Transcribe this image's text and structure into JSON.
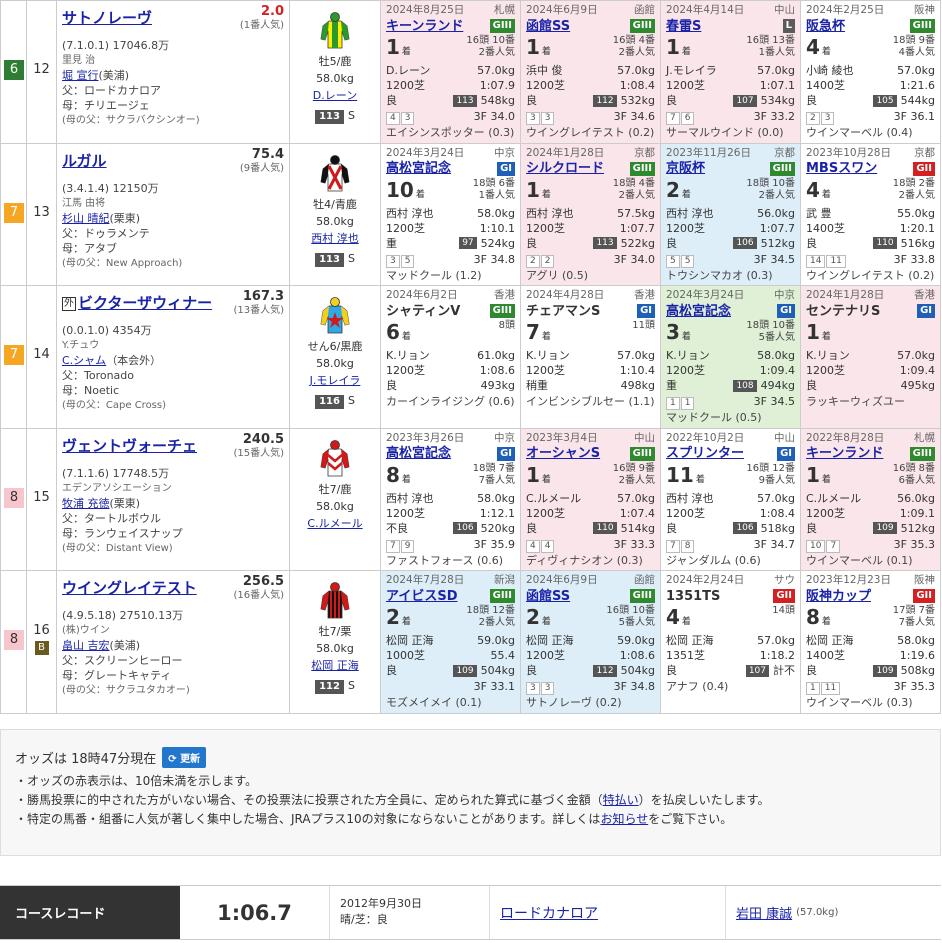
{
  "horses": [
    {
      "waku": "6",
      "waku_color": "#2e7d32",
      "waku_text_color": "#ffffff",
      "umaban": "12",
      "gaikoku": "",
      "blinker": "",
      "name": "サトノレーヴ",
      "odds": "2.0",
      "popularity": "(1番人気)",
      "record": "(7.1.0.1)",
      "prize": "17046.8万",
      "owner": "里見 治",
      "trainer": "堀 宣行",
      "trainer_loc": "(美浦)",
      "sire": "父：ロードカナロア",
      "dam": "母：チリエージェ",
      "damsire": "(母の父：サクラバクシンオー)",
      "sexage": "牡5/鹿",
      "weight": "58.0kg",
      "jockey": "D.レーン",
      "index": "113",
      "index_suffix": "S",
      "silk": {
        "body": "#ffee00",
        "sleeve": "#2b9a2b",
        "pattern": "stripe",
        "pattern_color": "#2b9a2b"
      },
      "past": [
        {
          "bg": "pink",
          "date": "2024年8月25日",
          "venue": "札幌",
          "race": "キーンランド",
          "link": true,
          "grade": "GIII",
          "gclass": "g3",
          "pos": "1",
          "field": "16頭 10番",
          "field2": "2番人気",
          "jockey": "D.レーン",
          "kg": "57.0kg",
          "dist": "1200芝",
          "time": "1:07.9",
          "track": "良",
          "idx": "113",
          "bw": "548kg",
          "n1": "4",
          "n2": "3",
          "l3f": "3F 34.0",
          "winner": "エイシンスポッター (0.3)"
        },
        {
          "bg": "pink",
          "date": "2024年6月9日",
          "venue": "函館",
          "race": "函館SS",
          "link": true,
          "grade": "GIII",
          "gclass": "g3",
          "pos": "1",
          "field": "16頭 4番",
          "field2": "2番人気",
          "jockey": "浜中 俊",
          "kg": "57.0kg",
          "dist": "1200芝",
          "time": "1:08.4",
          "track": "良",
          "idx": "112",
          "bw": "532kg",
          "n1": "3",
          "n2": "3",
          "l3f": "3F 34.6",
          "winner": "ウイングレイテスト (0.2)"
        },
        {
          "bg": "pink",
          "date": "2024年4月14日",
          "venue": "中山",
          "race": "春雷S",
          "link": true,
          "grade": "L",
          "gclass": "gL",
          "pos": "1",
          "field": "16頭 13番",
          "field2": "1番人気",
          "jockey": "J.モレイラ",
          "kg": "57.0kg",
          "dist": "1200芝",
          "time": "1:07.1",
          "track": "良",
          "idx": "107",
          "bw": "534kg",
          "n1": "7",
          "n2": "6",
          "l3f": "3F 33.2",
          "winner": "サーマルウインド (0.0)"
        },
        {
          "bg": "white",
          "date": "2024年2月25日",
          "venue": "阪神",
          "race": "阪急杯",
          "link": true,
          "grade": "GIII",
          "gclass": "g3",
          "pos": "4",
          "field": "18頭 9番",
          "field2": "4番人気",
          "jockey": "小崎 綾也",
          "kg": "57.0kg",
          "dist": "1400芝",
          "time": "1:21.6",
          "track": "良",
          "idx": "105",
          "bw": "544kg",
          "n1": "2",
          "n2": "3",
          "l3f": "3F 36.1",
          "winner": "ウインマーベル (0.4)"
        }
      ]
    },
    {
      "waku": "7",
      "waku_color": "#f5a623",
      "waku_text_color": "#ffffff",
      "umaban": "13",
      "gaikoku": "",
      "blinker": "",
      "name": "ルガル",
      "odds": "75.4",
      "popularity": "(9番人気)",
      "record": "(3.4.1.4)",
      "prize": "12150万",
      "owner": "江馬 由将",
      "trainer": "杉山 晴紀",
      "trainer_loc": "(栗東)",
      "sire": "父：ドゥラメンテ",
      "dam": "母：アタブ",
      "damsire": "(母の父：New Approach)",
      "sexage": "牡4/青鹿",
      "weight": "58.0kg",
      "jockey": "西村 淳也",
      "index": "113",
      "index_suffix": "S",
      "silk": {
        "body": "#ffffff",
        "sleeve": "#111111",
        "pattern": "cross",
        "pattern_color": "#d01a1a"
      },
      "past": [
        {
          "bg": "white",
          "date": "2024年3月24日",
          "venue": "中京",
          "race": "高松宮記念",
          "link": true,
          "grade": "GI",
          "gclass": "g1",
          "pos": "10",
          "field": "18頭 6番",
          "field2": "1番人気",
          "jockey": "西村 淳也",
          "kg": "58.0kg",
          "dist": "1200芝",
          "time": "1:10.1",
          "track": "重",
          "idx": "97",
          "bw": "524kg",
          "n1": "3",
          "n2": "5",
          "l3f": "3F 34.8",
          "winner": "マッドクール (1.2)"
        },
        {
          "bg": "pink",
          "date": "2024年1月28日",
          "venue": "京都",
          "race": "シルクロード",
          "link": true,
          "grade": "GIII",
          "gclass": "g3",
          "pos": "1",
          "field": "18頭 4番",
          "field2": "2番人気",
          "jockey": "西村 淳也",
          "kg": "57.5kg",
          "dist": "1200芝",
          "time": "1:07.7",
          "track": "良",
          "idx": "113",
          "bw": "522kg",
          "n1": "2",
          "n2": "2",
          "l3f": "3F 34.0",
          "winner": "アグリ (0.5)"
        },
        {
          "bg": "blue",
          "date": "2023年11月26日",
          "venue": "京都",
          "race": "京阪杯",
          "link": true,
          "grade": "GIII",
          "gclass": "g3",
          "pos": "2",
          "field": "18頭 10番",
          "field2": "2番人気",
          "jockey": "西村 淳也",
          "kg": "56.0kg",
          "dist": "1200芝",
          "time": "1:07.7",
          "track": "良",
          "idx": "106",
          "bw": "512kg",
          "n1": "5",
          "n2": "5",
          "l3f": "3F 34.5",
          "winner": "トウシンマカオ (0.3)"
        },
        {
          "bg": "white",
          "date": "2023年10月28日",
          "venue": "京都",
          "race": "MBSスワン",
          "link": true,
          "grade": "GII",
          "gclass": "g2",
          "pos": "4",
          "field": "18頭 2番",
          "field2": "2番人気",
          "jockey": "武 豊",
          "kg": "55.0kg",
          "dist": "1400芝",
          "time": "1:20.1",
          "track": "良",
          "idx": "110",
          "bw": "516kg",
          "n1": "14",
          "n2": "11",
          "l3f": "3F 33.8",
          "winner": "ウイングレイテスト (0.2)"
        }
      ]
    },
    {
      "waku": "7",
      "waku_color": "#f5a623",
      "waku_text_color": "#ffffff",
      "umaban": "14",
      "gaikoku": "外",
      "blinker": "",
      "name": "ビクターザウィナー",
      "odds": "167.3",
      "popularity": "(13番人気)",
      "record": "(0.0.1.0)",
      "prize": "4354万",
      "owner": "Y.チュウ",
      "trainer": "C.シャム",
      "trainer_loc": "（本会外）",
      "sire": "父：Toronado",
      "dam": "母：Noetic",
      "damsire": "(母の父：Cape Cross)",
      "sexage": "せん6/黒鹿",
      "weight": "58.0kg",
      "jockey": "J.モレイラ",
      "index": "116",
      "index_suffix": "S",
      "silk": {
        "body": "#2ea8e6",
        "sleeve": "#f2d01d",
        "pattern": "star",
        "pattern_color": "#d01a1a"
      },
      "past": [
        {
          "bg": "white",
          "date": "2024年6月2日",
          "venue": "香港",
          "race": "シャティンV",
          "link": false,
          "grade": "GIII",
          "gclass": "g3",
          "pos": "6",
          "field": "8頭",
          "field2": "",
          "jockey": "K.リョン",
          "kg": "61.0kg",
          "dist": "1200芝",
          "time": "1:08.6",
          "track": "良",
          "idx": "",
          "bw": "493kg",
          "n1": "",
          "n2": "",
          "l3f": "",
          "winner": "カーインライジング (0.6)"
        },
        {
          "bg": "white",
          "date": "2024年4月28日",
          "venue": "香港",
          "race": "チェアマンS",
          "link": false,
          "grade": "GI",
          "gclass": "g1",
          "pos": "7",
          "field": "11頭",
          "field2": "",
          "jockey": "K.リョン",
          "kg": "57.0kg",
          "dist": "1200芝",
          "time": "1:10.4",
          "track": "稍重",
          "idx": "",
          "bw": "498kg",
          "n1": "",
          "n2": "",
          "l3f": "",
          "winner": "インビンシブルセー (1.1)"
        },
        {
          "bg": "green",
          "date": "2024年3月24日",
          "venue": "中京",
          "race": "高松宮記念",
          "link": true,
          "grade": "GI",
          "gclass": "g1",
          "pos": "3",
          "field": "18頭 10番",
          "field2": "5番人気",
          "jockey": "K.リョン",
          "kg": "58.0kg",
          "dist": "1200芝",
          "time": "1:09.4",
          "track": "重",
          "idx": "108",
          "bw": "494kg",
          "n1": "1",
          "n2": "1",
          "l3f": "3F 34.5",
          "winner": "マッドクール (0.5)"
        },
        {
          "bg": "pink",
          "date": "2024年1月28日",
          "venue": "香港",
          "race": "センテナリS",
          "link": false,
          "grade": "GI",
          "gclass": "g1",
          "pos": "1",
          "field": "",
          "field2": "",
          "jockey": "K.リョン",
          "kg": "57.0kg",
          "dist": "1200芝",
          "time": "1:09.4",
          "track": "良",
          "idx": "",
          "bw": "495kg",
          "n1": "",
          "n2": "",
          "l3f": "",
          "winner": "ラッキーウィズユー"
        }
      ]
    },
    {
      "waku": "8",
      "waku_color": "#f7c6cc",
      "waku_text_color": "#333333",
      "umaban": "15",
      "gaikoku": "",
      "blinker": "",
      "name": "ヴェントヴォーチェ",
      "odds": "240.5",
      "popularity": "(15番人気)",
      "record": "(7.1.1.6)",
      "prize": "17748.5万",
      "owner": "エデンアソシエーション",
      "trainer": "牧浦 充徳",
      "trainer_loc": "(栗東)",
      "sire": "父：タートルボウル",
      "dam": "母：ランウェイスナップ",
      "damsire": "(母の父：Distant View)",
      "sexage": "牡7/鹿",
      "weight": "58.0kg",
      "jockey": "C.ルメール",
      "index": "",
      "index_suffix": "",
      "silk": {
        "body": "#ffffff",
        "sleeve": "#d01a1a",
        "pattern": "chevron",
        "pattern_color": "#d01a1a"
      },
      "past": [
        {
          "bg": "white",
          "date": "2023年3月26日",
          "venue": "中京",
          "race": "高松宮記念",
          "link": true,
          "grade": "GI",
          "gclass": "g1",
          "pos": "8",
          "field": "18頭 7番",
          "field2": "7番人気",
          "jockey": "西村 淳也",
          "kg": "58.0kg",
          "dist": "1200芝",
          "time": "1:12.1",
          "track": "不良",
          "idx": "106",
          "bw": "520kg",
          "n1": "7",
          "n2": "9",
          "l3f": "3F 35.9",
          "winner": "ファストフォース (0.6)"
        },
        {
          "bg": "pink",
          "date": "2023年3月4日",
          "venue": "中山",
          "race": "オーシャンS",
          "link": true,
          "grade": "GIII",
          "gclass": "g3",
          "pos": "1",
          "field": "16頭 9番",
          "field2": "2番人気",
          "jockey": "C.ルメール",
          "kg": "57.0kg",
          "dist": "1200芝",
          "time": "1:07.4",
          "track": "良",
          "idx": "110",
          "bw": "514kg",
          "n1": "4",
          "n2": "4",
          "l3f": "3F 33.3",
          "winner": "ディヴィナシオン (0.3)"
        },
        {
          "bg": "white",
          "date": "2022年10月2日",
          "venue": "中山",
          "race": "スプリンター",
          "link": true,
          "grade": "GI",
          "gclass": "g1",
          "pos": "11",
          "field": "16頭 12番",
          "field2": "9番人気",
          "jockey": "西村 淳也",
          "kg": "57.0kg",
          "dist": "1200芝",
          "time": "1:08.4",
          "track": "良",
          "idx": "106",
          "bw": "518kg",
          "n1": "7",
          "n2": "8",
          "l3f": "3F 34.7",
          "winner": "ジャンダルム (0.6)"
        },
        {
          "bg": "pink",
          "date": "2022年8月28日",
          "venue": "札幌",
          "race": "キーンランド",
          "link": true,
          "grade": "GIII",
          "gclass": "g3",
          "pos": "1",
          "field": "16頭 8番",
          "field2": "6番人気",
          "jockey": "C.ルメール",
          "kg": "56.0kg",
          "dist": "1200芝",
          "time": "1:09.1",
          "track": "良",
          "idx": "109",
          "bw": "512kg",
          "n1": "10",
          "n2": "7",
          "l3f": "3F 35.3",
          "winner": "ウインマーベル (0.1)"
        }
      ]
    },
    {
      "waku": "8",
      "waku_color": "#f7c6cc",
      "waku_text_color": "#333333",
      "umaban": "16",
      "gaikoku": "",
      "blinker": "B",
      "name": "ウイングレイテスト",
      "odds": "256.5",
      "popularity": "(16番人気)",
      "record": "(4.9.5.18)",
      "prize": "27510.13万",
      "owner": "(株)ウイン",
      "trainer": "畠山 吉宏",
      "trainer_loc": "(美浦)",
      "sire": "父：スクリーンヒーロー",
      "dam": "母：グレートキャティ",
      "damsire": "(母の父：サクラユタカオー)",
      "sexage": "牡7/栗",
      "weight": "58.0kg",
      "jockey": "松岡 正海",
      "index": "112",
      "index_suffix": "S",
      "silk": {
        "body": "#111111",
        "sleeve": "#d01a1a",
        "pattern": "vstripe",
        "pattern_color": "#d01a1a"
      },
      "past": [
        {
          "bg": "blue",
          "date": "2024年7月28日",
          "venue": "新潟",
          "race": "アイビスSD",
          "link": true,
          "grade": "GIII",
          "gclass": "g3",
          "pos": "2",
          "field": "18頭 12番",
          "field2": "2番人気",
          "jockey": "松岡 正海",
          "kg": "59.0kg",
          "dist": "1000芝",
          "time": "55.4",
          "track": "良",
          "idx": "109",
          "bw": "504kg",
          "n1": "",
          "n2": "",
          "l3f": "3F 33.1",
          "winner": "モズメイメイ (0.1)"
        },
        {
          "bg": "blue",
          "date": "2024年6月9日",
          "venue": "函館",
          "race": "函館SS",
          "link": true,
          "grade": "GIII",
          "gclass": "g3",
          "pos": "2",
          "field": "16頭 10番",
          "field2": "5番人気",
          "jockey": "松岡 正海",
          "kg": "59.0kg",
          "dist": "1200芝",
          "time": "1:08.6",
          "track": "良",
          "idx": "112",
          "bw": "504kg",
          "n1": "3",
          "n2": "3",
          "l3f": "3F 34.8",
          "winner": "サトノレーヴ (0.2)"
        },
        {
          "bg": "white",
          "date": "2024年2月24日",
          "venue": "サウ",
          "race": "1351TS",
          "link": false,
          "grade": "GII",
          "gclass": "g2",
          "pos": "4",
          "field": "14頭",
          "field2": "",
          "jockey": "松岡 正海",
          "kg": "57.0kg",
          "dist": "1351芝",
          "time": "1:18.2",
          "track": "良",
          "idx": "107",
          "bw": "計不",
          "n1": "",
          "n2": "",
          "l3f": "",
          "winner": "アナフ (0.4)"
        },
        {
          "bg": "white",
          "date": "2023年12月23日",
          "venue": "阪神",
          "race": "阪神カップ",
          "link": true,
          "grade": "GII",
          "gclass": "g2",
          "pos": "8",
          "field": "17頭 7番",
          "field2": "7番人気",
          "jockey": "松岡 正海",
          "kg": "58.0kg",
          "dist": "1400芝",
          "time": "1:19.6",
          "track": "良",
          "idx": "109",
          "bw": "508kg",
          "n1": "1",
          "n2": "11",
          "l3f": "3F 35.3",
          "winner": "ウインマーベル (0.3)"
        }
      ]
    }
  ],
  "notice": {
    "odds_time": "オッズは 18時47分現在",
    "refresh_label": "更新",
    "line1": "・オッズの赤表示は、10倍未満を示します。",
    "line2_pre": "・勝馬投票に的中された方がいない場合、その投票法に投票された方全員に、定められた算式に基づく金額（",
    "line2_link": "特払い",
    "line2_post": "）を払戻しいたします。",
    "line3_pre": "・特定の馬番・組番に人気が著しく集中した場合、JRAプラス10の対象にならないことがあります。詳しくは",
    "line3_link": "お知らせ",
    "line3_post": "をご覧下さい。"
  },
  "course_record": {
    "label": "コースレコード",
    "time": "1:06.7",
    "date": "2012年9月30日",
    "cond": "晴/芝：良",
    "horse": "ロードカナロア",
    "jockey": "岩田 康誠",
    "jockey_wt": "(57.0kg)"
  },
  "colors": {
    "pink": "#fae6ea",
    "blue": "#ddeef8",
    "green": "#dff0d6",
    "white": "#ffffff",
    "odds_red": "#d32121"
  }
}
